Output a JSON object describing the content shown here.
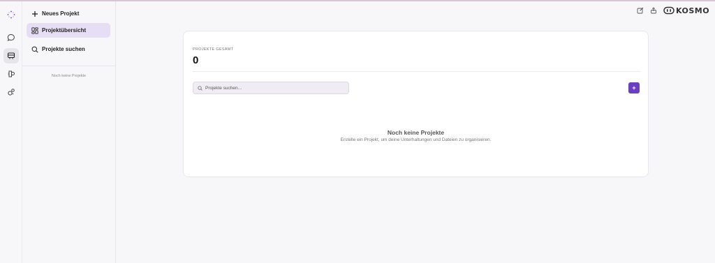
{
  "brand": {
    "name": "KOSMO"
  },
  "sidebar": {
    "items": [
      {
        "label": "Neues Projekt",
        "icon": "plus-icon"
      },
      {
        "label": "Projektübersicht",
        "icon": "grid-icon",
        "active": true
      },
      {
        "label": "Projekte suchen",
        "icon": "search-icon"
      }
    ],
    "empty_text": "Noch keine Projekte"
  },
  "main": {
    "stat_label": "PROJEKTE GESAMT",
    "stat_value": "0",
    "search_placeholder": "Projekte suchen...",
    "add_label": "+",
    "empty_title": "Noch keine Projekte",
    "empty_subtitle": "Erstelle ein Projekt, um deine Unterhaltungen und Dateien zu organisieren."
  },
  "colors": {
    "accent": "#6a3fc0",
    "active_item_bg": "#e6def4",
    "page_bg": "#f7f7f9"
  }
}
